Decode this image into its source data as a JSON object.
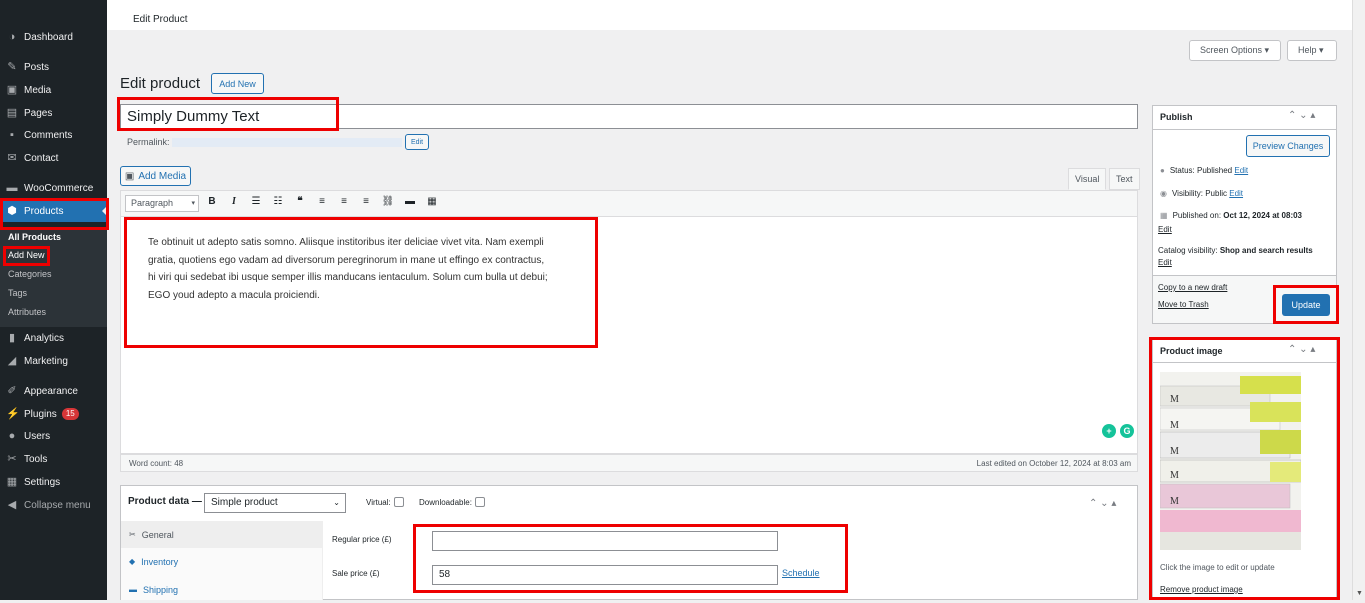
{
  "sidebar": {
    "items": [
      {
        "label": "Dashboard",
        "icon": "dashboard-icon",
        "glyph": "◑"
      },
      {
        "label": "Posts",
        "icon": "pin-icon",
        "glyph": "✎"
      },
      {
        "label": "Media",
        "icon": "media-icon",
        "glyph": "▣"
      },
      {
        "label": "Pages",
        "icon": "pages-icon",
        "glyph": "▤"
      },
      {
        "label": "Comments",
        "icon": "comments-icon",
        "glyph": "▪"
      },
      {
        "label": "Contact",
        "icon": "mail-icon",
        "glyph": "✉"
      },
      {
        "label": "WooCommerce",
        "icon": "woo-icon",
        "glyph": "▬"
      },
      {
        "label": "Products",
        "icon": "box-icon",
        "glyph": "⬢"
      },
      {
        "label": "Analytics",
        "icon": "bar-chart-icon",
        "glyph": "▮"
      },
      {
        "label": "Marketing",
        "icon": "megaphone-icon",
        "glyph": "◢"
      },
      {
        "label": "Appearance",
        "icon": "brush-icon",
        "glyph": "✐"
      },
      {
        "label": "Plugins",
        "icon": "plug-icon",
        "glyph": "⚡",
        "badge": "15"
      },
      {
        "label": "Users",
        "icon": "user-icon",
        "glyph": "●"
      },
      {
        "label": "Tools",
        "icon": "wrench-icon",
        "glyph": "✂"
      },
      {
        "label": "Settings",
        "icon": "settings-icon",
        "glyph": "▦"
      },
      {
        "label": "Collapse menu",
        "icon": "collapse-icon",
        "glyph": "◀"
      }
    ],
    "submenu": [
      "All Products",
      "Add New",
      "Categories",
      "Tags",
      "Attributes"
    ]
  },
  "header": {
    "breadcrumb": "Edit Product",
    "screen_options": "Screen Options ▾",
    "help": "Help ▾"
  },
  "page": {
    "title": "Edit product",
    "add_new": "Add New",
    "product_title": "Simply Dummy Text",
    "permalink_label": "Permalink:",
    "permalink_edit": "Edit"
  },
  "editor": {
    "add_media": "Add Media",
    "tab_visual": "Visual",
    "tab_text": "Text",
    "format_select": "Paragraph",
    "content": "Te obtinuit ut adepto satis somno. Aliisque institoribus iter deliciae vivet vita. Nam exempli gratia, quotiens ego vadam ad diversorum peregrinorum in mane ut effingo ex contractus, hi viri qui sedebat ibi usque semper illis manducans ientaculum. Solum cum bulla ut debui; EGO youd adepto a macula proiciendi.",
    "word_count": "Word count: 48",
    "last_edited": "Last edited on October 12, 2024 at 8:03 am"
  },
  "product_data": {
    "label": "Product data —",
    "type": "Simple product",
    "virtual": "Virtual:",
    "downloadable": "Downloadable:",
    "tabs": [
      "General",
      "Inventory",
      "Shipping"
    ],
    "regular_price_label": "Regular price (£)",
    "regular_price": "",
    "sale_price_label": "Sale price (£)",
    "sale_price": "58",
    "schedule": "Schedule"
  },
  "publish": {
    "title": "Publish",
    "preview": "Preview Changes",
    "status_label": "Status:",
    "status_value": "Published",
    "status_edit": "Edit",
    "visibility_label": "Visibility:",
    "visibility_value": "Public",
    "visibility_edit": "Edit",
    "published_label": "Published on:",
    "published_value": "Oct 12, 2024 at 08:03",
    "published_edit": "Edit",
    "catalog_label": "Catalog visibility:",
    "catalog_value": "Shop and search results",
    "catalog_edit": "Edit",
    "copy_draft": "Copy to a new draft",
    "trash": "Move to Trash",
    "update": "Update"
  },
  "product_image": {
    "title": "Product image",
    "hint": "Click the image to edit or update",
    "remove": "Remove product image"
  },
  "colors": {
    "sidebar_bg": "#1d2327",
    "accent": "#2271b1",
    "highlight": "#e00000",
    "badge": "#d63638"
  }
}
